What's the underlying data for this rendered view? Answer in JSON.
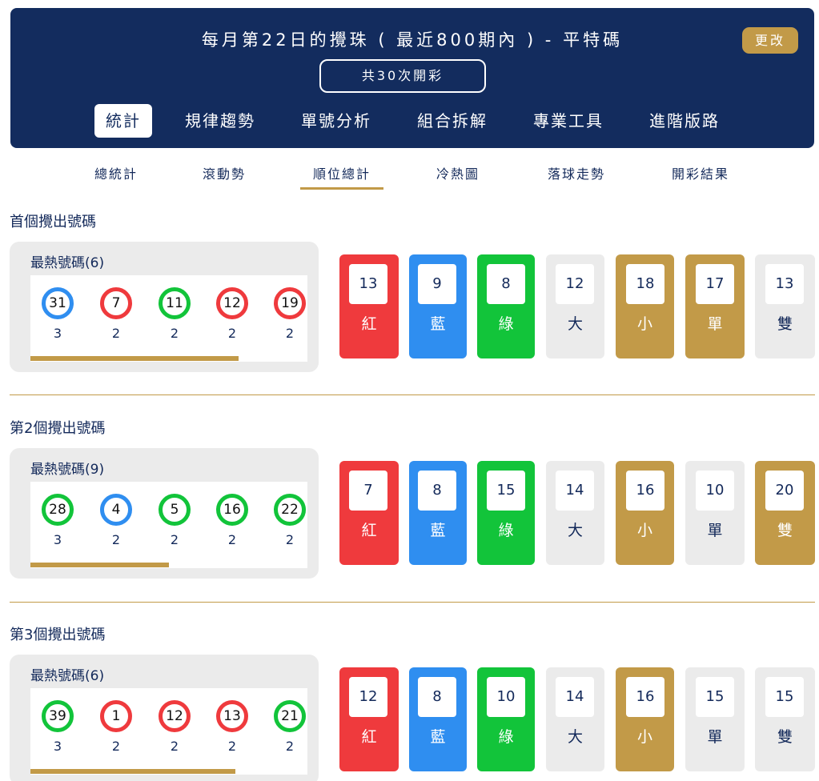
{
  "header": {
    "title": "每月第22日的攪珠 ( 最近800期內 ) - 平特碼",
    "change_label": "更改",
    "draws_label": "共30次開彩"
  },
  "main_nav": [
    "統計",
    "規律趨勢",
    "單號分析",
    "組合拆解",
    "專業工具",
    "進階版路"
  ],
  "sub_nav": [
    "總統計",
    "滾動勢",
    "順位總計",
    "冷熱圖",
    "落球走勢",
    "開彩結果"
  ],
  "active_main": "統計",
  "active_sub": "順位總計",
  "colors": {
    "navy": "#132c5e",
    "gold": "#c29a48",
    "red": "#ef3a3d",
    "blue": "#2f8ef0",
    "green": "#12c43a",
    "light": "#ebebeb"
  },
  "sections": [
    {
      "title": "首個攪出號碼",
      "hot_title": "最熱號碼(6)",
      "balls": [
        {
          "num": "31",
          "color": "blue",
          "count": "3"
        },
        {
          "num": "7",
          "color": "red",
          "count": "2"
        },
        {
          "num": "11",
          "color": "green",
          "count": "2"
        },
        {
          "num": "12",
          "color": "red",
          "count": "2"
        },
        {
          "num": "19",
          "color": "red",
          "count": "2"
        }
      ],
      "scroll_fraction": 0.75,
      "stats": [
        {
          "value": "13",
          "label": "紅",
          "style": "red"
        },
        {
          "value": "9",
          "label": "藍",
          "style": "blue"
        },
        {
          "value": "8",
          "label": "綠",
          "style": "green"
        },
        {
          "value": "12",
          "label": "大",
          "style": "plain"
        },
        {
          "value": "18",
          "label": "小",
          "style": "gold"
        },
        {
          "value": "17",
          "label": "單",
          "style": "gold"
        },
        {
          "value": "13",
          "label": "雙",
          "style": "plain"
        }
      ]
    },
    {
      "title": "第2個攪出號碼",
      "hot_title": "最熱號碼(9)",
      "balls": [
        {
          "num": "28",
          "color": "green",
          "count": "3"
        },
        {
          "num": "4",
          "color": "blue",
          "count": "2"
        },
        {
          "num": "5",
          "color": "green",
          "count": "2"
        },
        {
          "num": "16",
          "color": "green",
          "count": "2"
        },
        {
          "num": "22",
          "color": "green",
          "count": "2"
        }
      ],
      "scroll_fraction": 0.5,
      "stats": [
        {
          "value": "7",
          "label": "紅",
          "style": "red"
        },
        {
          "value": "8",
          "label": "藍",
          "style": "blue"
        },
        {
          "value": "15",
          "label": "綠",
          "style": "green"
        },
        {
          "value": "14",
          "label": "大",
          "style": "plain"
        },
        {
          "value": "16",
          "label": "小",
          "style": "gold"
        },
        {
          "value": "10",
          "label": "單",
          "style": "plain"
        },
        {
          "value": "20",
          "label": "雙",
          "style": "gold"
        }
      ]
    },
    {
      "title": "第3個攪出號碼",
      "hot_title": "最熱號碼(6)",
      "balls": [
        {
          "num": "39",
          "color": "green",
          "count": "3"
        },
        {
          "num": "1",
          "color": "red",
          "count": "2"
        },
        {
          "num": "12",
          "color": "red",
          "count": "2"
        },
        {
          "num": "13",
          "color": "red",
          "count": "2"
        },
        {
          "num": "21",
          "color": "green",
          "count": "2"
        }
      ],
      "scroll_fraction": 0.74,
      "stats": [
        {
          "value": "12",
          "label": "紅",
          "style": "red"
        },
        {
          "value": "8",
          "label": "藍",
          "style": "blue"
        },
        {
          "value": "10",
          "label": "綠",
          "style": "green"
        },
        {
          "value": "14",
          "label": "大",
          "style": "plain"
        },
        {
          "value": "16",
          "label": "小",
          "style": "gold"
        },
        {
          "value": "15",
          "label": "單",
          "style": "plain"
        },
        {
          "value": "15",
          "label": "雙",
          "style": "plain"
        }
      ]
    }
  ]
}
